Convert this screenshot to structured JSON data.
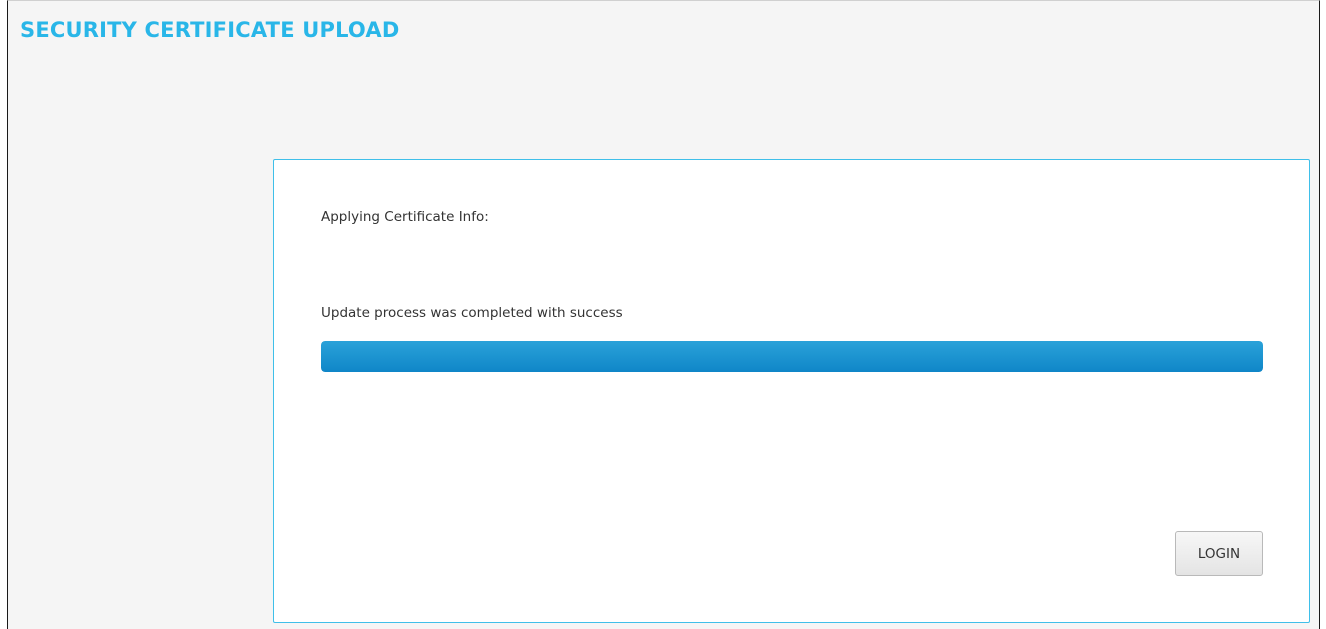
{
  "page": {
    "title": "SECURITY CERTIFICATE UPLOAD"
  },
  "panel": {
    "applying_label": "Applying Certificate Info:",
    "status_message": "Update process was completed with success",
    "progress": {
      "percent": 100,
      "fill_color": "#1593d1"
    },
    "login_button": "LOGIN"
  },
  "colors": {
    "accent": "#29b6e8",
    "panel_border": "#3fbfe9",
    "background": "#f5f5f5"
  }
}
